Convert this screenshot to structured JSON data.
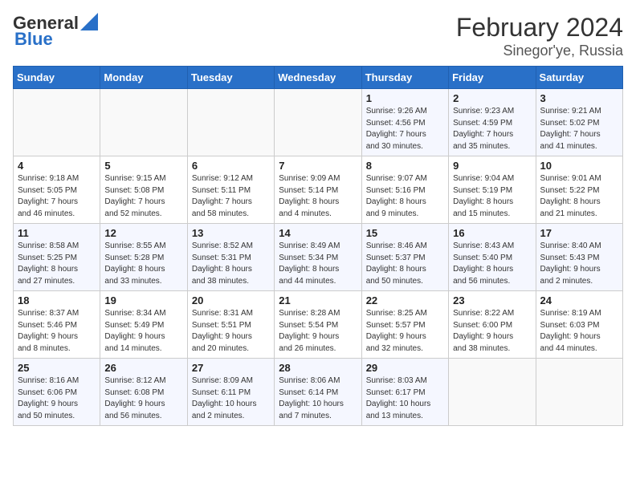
{
  "header": {
    "logo_line1": "General",
    "logo_line2": "Blue",
    "title": "February 2024",
    "subtitle": "Sinegor'ye, Russia"
  },
  "weekdays": [
    "Sunday",
    "Monday",
    "Tuesday",
    "Wednesday",
    "Thursday",
    "Friday",
    "Saturday"
  ],
  "weeks": [
    [
      {
        "day": "",
        "info": ""
      },
      {
        "day": "",
        "info": ""
      },
      {
        "day": "",
        "info": ""
      },
      {
        "day": "",
        "info": ""
      },
      {
        "day": "1",
        "info": "Sunrise: 9:26 AM\nSunset: 4:56 PM\nDaylight: 7 hours\nand 30 minutes."
      },
      {
        "day": "2",
        "info": "Sunrise: 9:23 AM\nSunset: 4:59 PM\nDaylight: 7 hours\nand 35 minutes."
      },
      {
        "day": "3",
        "info": "Sunrise: 9:21 AM\nSunset: 5:02 PM\nDaylight: 7 hours\nand 41 minutes."
      }
    ],
    [
      {
        "day": "4",
        "info": "Sunrise: 9:18 AM\nSunset: 5:05 PM\nDaylight: 7 hours\nand 46 minutes."
      },
      {
        "day": "5",
        "info": "Sunrise: 9:15 AM\nSunset: 5:08 PM\nDaylight: 7 hours\nand 52 minutes."
      },
      {
        "day": "6",
        "info": "Sunrise: 9:12 AM\nSunset: 5:11 PM\nDaylight: 7 hours\nand 58 minutes."
      },
      {
        "day": "7",
        "info": "Sunrise: 9:09 AM\nSunset: 5:14 PM\nDaylight: 8 hours\nand 4 minutes."
      },
      {
        "day": "8",
        "info": "Sunrise: 9:07 AM\nSunset: 5:16 PM\nDaylight: 8 hours\nand 9 minutes."
      },
      {
        "day": "9",
        "info": "Sunrise: 9:04 AM\nSunset: 5:19 PM\nDaylight: 8 hours\nand 15 minutes."
      },
      {
        "day": "10",
        "info": "Sunrise: 9:01 AM\nSunset: 5:22 PM\nDaylight: 8 hours\nand 21 minutes."
      }
    ],
    [
      {
        "day": "11",
        "info": "Sunrise: 8:58 AM\nSunset: 5:25 PM\nDaylight: 8 hours\nand 27 minutes."
      },
      {
        "day": "12",
        "info": "Sunrise: 8:55 AM\nSunset: 5:28 PM\nDaylight: 8 hours\nand 33 minutes."
      },
      {
        "day": "13",
        "info": "Sunrise: 8:52 AM\nSunset: 5:31 PM\nDaylight: 8 hours\nand 38 minutes."
      },
      {
        "day": "14",
        "info": "Sunrise: 8:49 AM\nSunset: 5:34 PM\nDaylight: 8 hours\nand 44 minutes."
      },
      {
        "day": "15",
        "info": "Sunrise: 8:46 AM\nSunset: 5:37 PM\nDaylight: 8 hours\nand 50 minutes."
      },
      {
        "day": "16",
        "info": "Sunrise: 8:43 AM\nSunset: 5:40 PM\nDaylight: 8 hours\nand 56 minutes."
      },
      {
        "day": "17",
        "info": "Sunrise: 8:40 AM\nSunset: 5:43 PM\nDaylight: 9 hours\nand 2 minutes."
      }
    ],
    [
      {
        "day": "18",
        "info": "Sunrise: 8:37 AM\nSunset: 5:46 PM\nDaylight: 9 hours\nand 8 minutes."
      },
      {
        "day": "19",
        "info": "Sunrise: 8:34 AM\nSunset: 5:49 PM\nDaylight: 9 hours\nand 14 minutes."
      },
      {
        "day": "20",
        "info": "Sunrise: 8:31 AM\nSunset: 5:51 PM\nDaylight: 9 hours\nand 20 minutes."
      },
      {
        "day": "21",
        "info": "Sunrise: 8:28 AM\nSunset: 5:54 PM\nDaylight: 9 hours\nand 26 minutes."
      },
      {
        "day": "22",
        "info": "Sunrise: 8:25 AM\nSunset: 5:57 PM\nDaylight: 9 hours\nand 32 minutes."
      },
      {
        "day": "23",
        "info": "Sunrise: 8:22 AM\nSunset: 6:00 PM\nDaylight: 9 hours\nand 38 minutes."
      },
      {
        "day": "24",
        "info": "Sunrise: 8:19 AM\nSunset: 6:03 PM\nDaylight: 9 hours\nand 44 minutes."
      }
    ],
    [
      {
        "day": "25",
        "info": "Sunrise: 8:16 AM\nSunset: 6:06 PM\nDaylight: 9 hours\nand 50 minutes."
      },
      {
        "day": "26",
        "info": "Sunrise: 8:12 AM\nSunset: 6:08 PM\nDaylight: 9 hours\nand 56 minutes."
      },
      {
        "day": "27",
        "info": "Sunrise: 8:09 AM\nSunset: 6:11 PM\nDaylight: 10 hours\nand 2 minutes."
      },
      {
        "day": "28",
        "info": "Sunrise: 8:06 AM\nSunset: 6:14 PM\nDaylight: 10 hours\nand 7 minutes."
      },
      {
        "day": "29",
        "info": "Sunrise: 8:03 AM\nSunset: 6:17 PM\nDaylight: 10 hours\nand 13 minutes."
      },
      {
        "day": "",
        "info": ""
      },
      {
        "day": "",
        "info": ""
      }
    ]
  ]
}
